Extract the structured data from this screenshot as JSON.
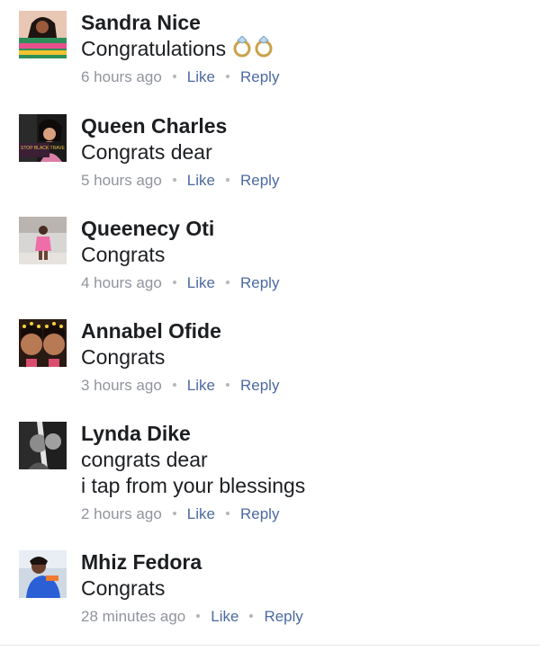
{
  "comments": [
    {
      "name": "Sandra Nice",
      "text": "Congratulations",
      "emoji": "ring-icon",
      "time": "6 hours ago",
      "like": "Like",
      "reply": "Reply"
    },
    {
      "name": "Queen Charles",
      "text": "Congrats dear",
      "time": "5 hours ago",
      "like": "Like",
      "reply": "Reply",
      "avatar_caption": "STOP BLACK TRAVE"
    },
    {
      "name": "Queenecy Oti",
      "text": "Congrats",
      "time": "4 hours ago",
      "like": "Like",
      "reply": "Reply"
    },
    {
      "name": "Annabel Ofide",
      "text": "Congrats",
      "time": "3 hours ago",
      "like": "Like",
      "reply": "Reply"
    },
    {
      "name": "Lynda Dike",
      "text_line1": "congrats dear",
      "text_line2": "i tap from your blessings",
      "time": "2 hours ago",
      "like": "Like",
      "reply": "Reply"
    },
    {
      "name": "Mhiz Fedora",
      "text": "Congrats",
      "time": "28 minutes ago",
      "like": "Like",
      "reply": "Reply"
    }
  ],
  "colors": {
    "name_text": "#1c1e21",
    "meta_text": "#90949c",
    "action_link": "#4b6aa2"
  }
}
